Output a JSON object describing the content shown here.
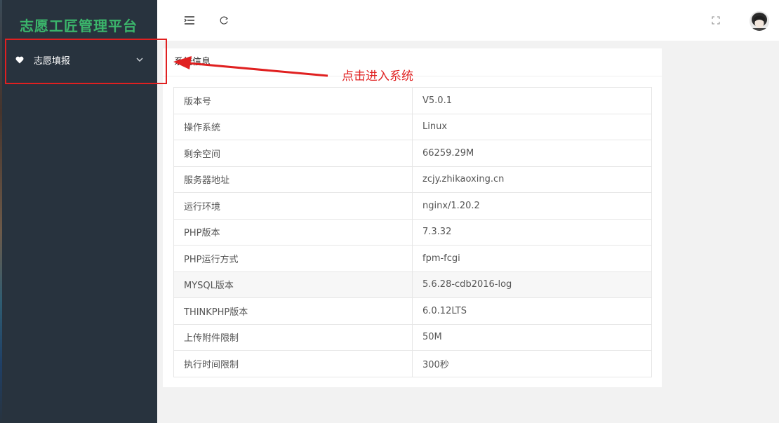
{
  "app": {
    "title": "志愿工匠管理平台"
  },
  "sidebar": {
    "items": [
      {
        "label": "志愿填报",
        "icon": "heart-icon"
      }
    ]
  },
  "header": {
    "icons": [
      "menu-toggle-icon",
      "refresh-icon",
      "fullscreen-icon",
      "avatar"
    ]
  },
  "card": {
    "title": "系统信息"
  },
  "system_info": [
    {
      "key": "版本号",
      "value": "V5.0.1"
    },
    {
      "key": "操作系统",
      "value": "Linux"
    },
    {
      "key": "剩余空间",
      "value": "66259.29M"
    },
    {
      "key": "服务器地址",
      "value": "zcjy.zhikaoxing.cn"
    },
    {
      "key": "运行环境",
      "value": "nginx/1.20.2"
    },
    {
      "key": "PHP版本",
      "value": "7.3.32"
    },
    {
      "key": "PHP运行方式",
      "value": "fpm-fcgi"
    },
    {
      "key": "MYSQL版本",
      "value": "5.6.28-cdb2016-log"
    },
    {
      "key": "THINKPHP版本",
      "value": "6.0.12LTS"
    },
    {
      "key": "上传附件限制",
      "value": "50M"
    },
    {
      "key": "执行时间限制",
      "value": "300秒"
    }
  ],
  "annotation": {
    "text": "点击进入系统",
    "color": "#e02020"
  },
  "colors": {
    "sidebar_bg": "#28333e",
    "logo_green": "#3bb56b",
    "annotation_red": "#e02020"
  }
}
